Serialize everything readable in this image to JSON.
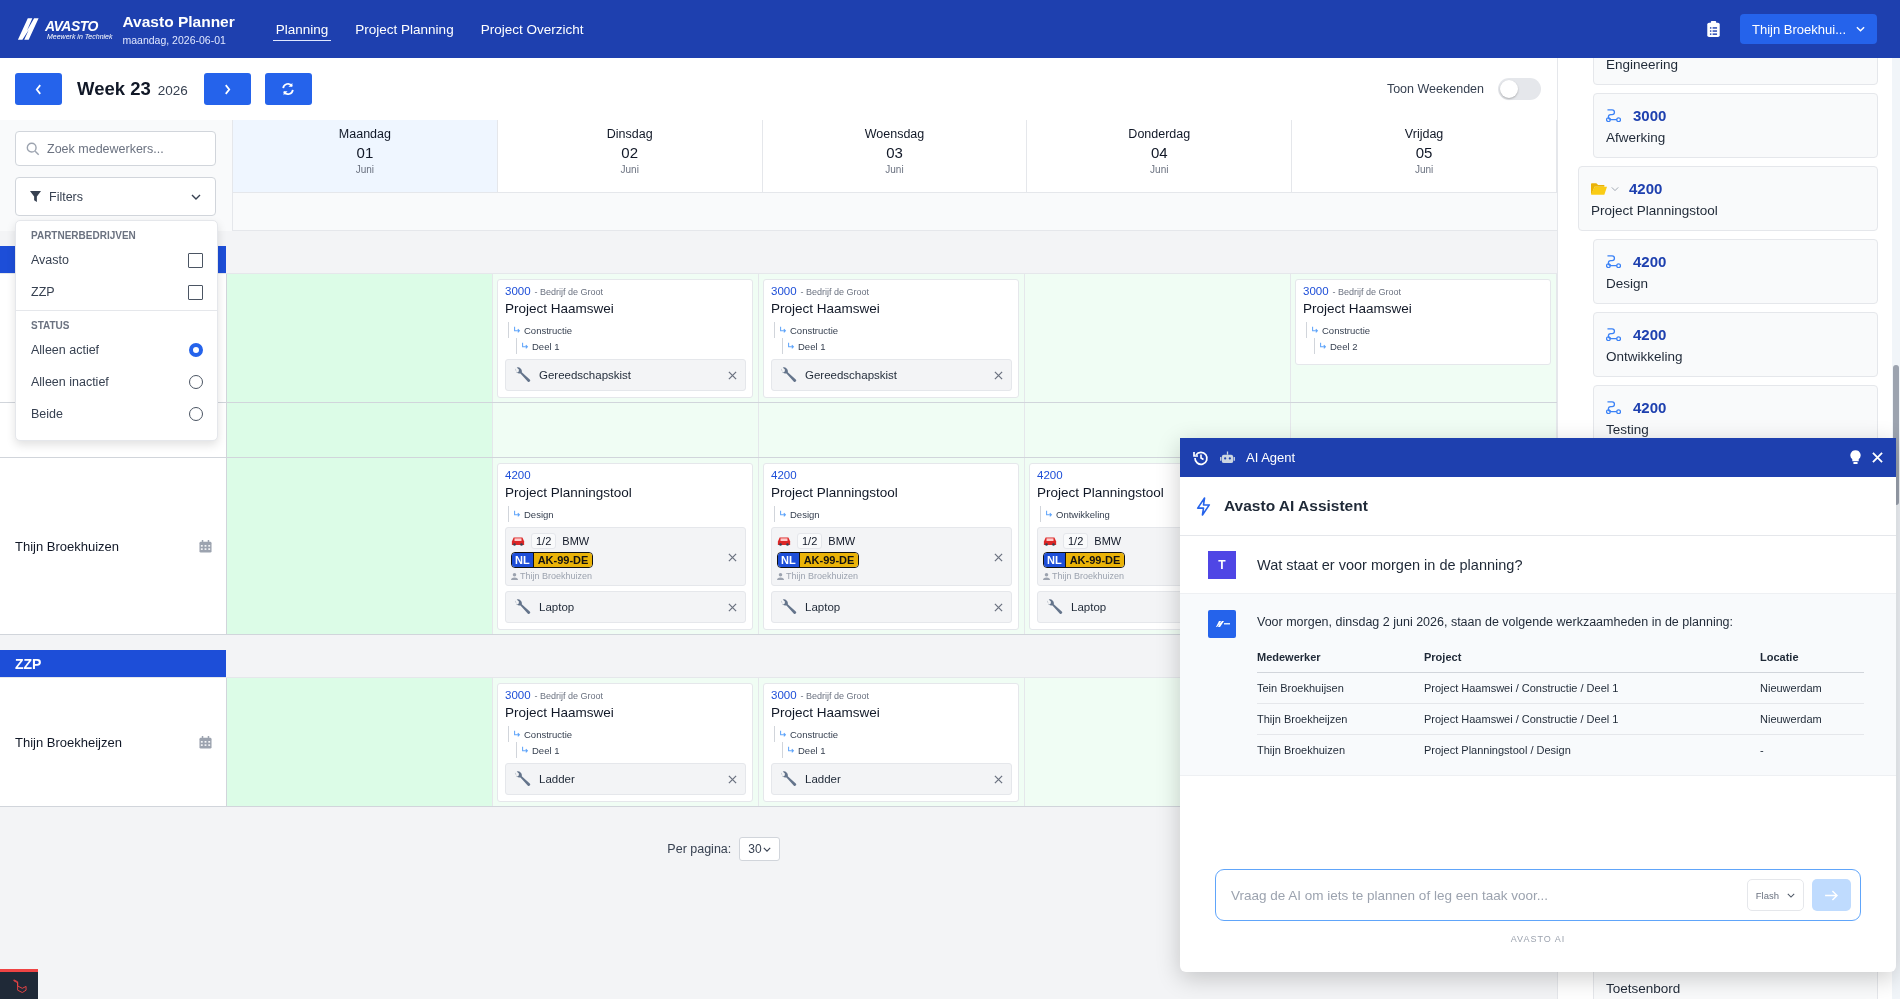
{
  "app": {
    "wordmark": "AVASTO",
    "tagline": "Meewerk in Techniek",
    "title": "Avasto Planner",
    "date": "maandag, 2026-06-01"
  },
  "nav": [
    {
      "label": "Planning",
      "selected": true
    },
    {
      "label": "Project Planning",
      "selected": false
    },
    {
      "label": "Project Overzicht",
      "selected": false
    }
  ],
  "user_menu": {
    "label": "Thijn Broekhui..."
  },
  "week": {
    "label": "Week 23",
    "year": "2026"
  },
  "weekend_toggle": {
    "label": "Toon Weekenden",
    "on": false
  },
  "search": {
    "placeholder": "Zoek medewerkers..."
  },
  "filters": {
    "label": "Filters",
    "expanded": true,
    "sections": [
      {
        "title": "PARTNERBEDRIJVEN",
        "kind": "checkbox",
        "options": [
          {
            "label": "Avasto",
            "checked": false
          },
          {
            "label": "ZZP",
            "checked": false
          }
        ]
      },
      {
        "title": "STATUS",
        "kind": "radio",
        "options": [
          {
            "label": "Alleen actief",
            "selected": true
          },
          {
            "label": "Alleen inactief",
            "selected": false
          },
          {
            "label": "Beide",
            "selected": false
          }
        ]
      }
    ]
  },
  "days": [
    {
      "name": "Maandag",
      "date": "01",
      "month": "Juni",
      "selected": true
    },
    {
      "name": "Dinsdag",
      "date": "02",
      "month": "Juni",
      "selected": false
    },
    {
      "name": "Woensdag",
      "date": "03",
      "month": "Juni",
      "selected": false
    },
    {
      "name": "Donderdag",
      "date": "04",
      "month": "Juni",
      "selected": false
    },
    {
      "name": "Vrijdag",
      "date": "05",
      "month": "Juni",
      "selected": false
    }
  ],
  "groups": [
    {
      "rows": [
        {
          "cells": [
            {},
            {
              "card": {
                "code": "3000",
                "company": "- Bedrijf de Groot",
                "title": "Project Haamswei",
                "path": [
                  {
                    "label": "Constructie",
                    "children": [
                      {
                        "label": "Deel 1"
                      }
                    ]
                  }
                ],
                "resources": [
                  {
                    "kind": "tool",
                    "label": "Gereedschapskist",
                    "removable": true
                  }
                ]
              }
            },
            {
              "card": {
                "code": "3000",
                "company": "- Bedrijf de Groot",
                "title": "Project Haamswei",
                "path": [
                  {
                    "label": "Constructie",
                    "children": [
                      {
                        "label": "Deel 1"
                      }
                    ]
                  }
                ],
                "resources": [
                  {
                    "kind": "tool",
                    "label": "Gereedschapskist",
                    "removable": true
                  }
                ]
              }
            },
            {},
            {
              "card": {
                "code": "3000",
                "company": "- Bedrijf de Groot",
                "title": "Project Haamswei",
                "path": [
                  {
                    "label": "Constructie",
                    "children": [
                      {
                        "label": "Deel 2"
                      }
                    ]
                  }
                ]
              }
            }
          ]
        },
        {
          "cells": [
            {},
            {},
            {},
            {},
            {}
          ]
        },
        {
          "name": "Thijn Broekhuizen",
          "cells": [
            {},
            {
              "card": {
                "code": "4200",
                "title": "Project Planningstool",
                "path": [
                  {
                    "label": "Design"
                  }
                ],
                "resources": [
                  {
                    "kind": "vehicle",
                    "fraction": "1/2",
                    "brand": "BMW",
                    "country": "NL",
                    "plate": "AK-99-DE",
                    "driver": "Thijn Broekhuizen",
                    "removable": true
                  },
                  {
                    "kind": "tool",
                    "label": "Laptop",
                    "removable": true
                  }
                ]
              }
            },
            {
              "card": {
                "code": "4200",
                "title": "Project Planningstool",
                "path": [
                  {
                    "label": "Design"
                  }
                ],
                "resources": [
                  {
                    "kind": "vehicle",
                    "fraction": "1/2",
                    "brand": "BMW",
                    "country": "NL",
                    "plate": "AK-99-DE",
                    "driver": "Thijn Broekhuizen",
                    "removable": true
                  },
                  {
                    "kind": "tool",
                    "label": "Laptop",
                    "removable": true
                  }
                ]
              }
            },
            {
              "card": {
                "code": "4200",
                "title": "Project Planningstool",
                "path": [
                  {
                    "label": "Ontwikkeling"
                  }
                ],
                "resources": [
                  {
                    "kind": "vehicle",
                    "fraction": "1/2",
                    "brand": "BMW",
                    "country": "NL",
                    "plate": "AK-99-DE",
                    "driver": "Thijn Broekhuizen",
                    "removable": false
                  },
                  {
                    "kind": "tool",
                    "label": "Laptop",
                    "removable": false
                  }
                ]
              }
            }
          ]
        }
      ]
    },
    {
      "label": "ZZP",
      "rows": [
        {
          "name": "Thijn Broekheijzen",
          "cells": [
            {},
            {
              "card": {
                "code": "3000",
                "company": "- Bedrijf de Groot",
                "title": "Project Haamswei",
                "path": [
                  {
                    "label": "Constructie",
                    "children": [
                      {
                        "label": "Deel 1"
                      }
                    ]
                  }
                ],
                "resources": [
                  {
                    "kind": "tool",
                    "label": "Ladder",
                    "removable": true
                  }
                ]
              }
            },
            {
              "card": {
                "code": "3000",
                "company": "- Bedrijf de Groot",
                "title": "Project Haamswei",
                "path": [
                  {
                    "label": "Constructie",
                    "children": [
                      {
                        "label": "Deel 1"
                      }
                    ]
                  }
                ],
                "resources": [
                  {
                    "kind": "tool",
                    "label": "Ladder",
                    "removable": true
                  }
                ]
              }
            },
            {}
          ]
        }
      ]
    }
  ],
  "pagination": {
    "label": "Per pagina:",
    "value": "30"
  },
  "sidebar": {
    "items": [
      {
        "kind": "phase",
        "label": "Engineering"
      },
      {
        "kind": "phase",
        "code": "3000",
        "label": "Afwerking"
      },
      {
        "kind": "project",
        "code": "4200",
        "label": "Project Planningstool",
        "expanded": true
      },
      {
        "kind": "phase",
        "code": "4200",
        "label": "Design"
      },
      {
        "kind": "phase",
        "code": "4200",
        "label": "Ontwikkeling"
      },
      {
        "kind": "phase",
        "code": "4200",
        "label": "Testing"
      },
      {
        "kind": "phase",
        "label": "Toetsenbord"
      }
    ]
  },
  "ai_panel": {
    "title": "AI Agent",
    "assistant_name": "Avasto AI Assistent",
    "messages": [
      {
        "kind": "question",
        "avatar": "T",
        "text": "Wat staat er voor morgen in de planning?"
      },
      {
        "kind": "answer",
        "text": "Voor morgen, dinsdag 2 juni 2026, staan de volgende werkzaamheden in de planning:",
        "table": {
          "columns": [
            "Medewerker",
            "Project",
            "Locatie"
          ],
          "rows": [
            [
              "Tein Broekhuijsen",
              "Project Haamswei / Constructie / Deel 1",
              "Nieuwerdam"
            ],
            [
              "Thijn Broekheijzen",
              "Project Haamswei / Constructie / Deel 1",
              "Nieuwerdam"
            ],
            [
              "Thijn Broekhuizen",
              "Project Planningstool / Design",
              "-"
            ]
          ]
        }
      }
    ],
    "input": {
      "placeholder": "Vraag de AI om iets te plannen of leg een taak voor...",
      "model": "Flash",
      "send_disabled": true
    },
    "footer": "AVASTO AI"
  }
}
